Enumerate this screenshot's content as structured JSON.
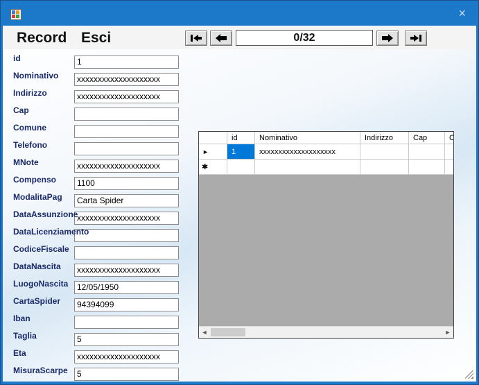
{
  "window": {
    "close_glyph": "×"
  },
  "menu": {
    "record": "Record",
    "exit": "Esci"
  },
  "nav": {
    "counter": "0/32",
    "first_icon": "first-record-icon",
    "prev_icon": "prev-record-icon",
    "next_icon": "next-record-icon",
    "last_icon": "last-record-icon"
  },
  "fields": [
    {
      "label": "id",
      "value": "1"
    },
    {
      "label": "Nominativo",
      "value": "xxxxxxxxxxxxxxxxxxxx"
    },
    {
      "label": "Indirizzo",
      "value": "xxxxxxxxxxxxxxxxxxxx"
    },
    {
      "label": "Cap",
      "value": ""
    },
    {
      "label": "Comune",
      "value": ""
    },
    {
      "label": "Telefono",
      "value": ""
    },
    {
      "label": "MNote",
      "value": "xxxxxxxxxxxxxxxxxxxx"
    },
    {
      "label": "Compenso",
      "value": "1100"
    },
    {
      "label": "ModalitaPag",
      "value": "Carta Spider"
    },
    {
      "label": "DataAssunzione",
      "value": "xxxxxxxxxxxxxxxxxxxx"
    },
    {
      "label": "DataLicenziamento",
      "value": ""
    },
    {
      "label": "CodiceFiscale",
      "value": ""
    },
    {
      "label": "DataNascita",
      "value": "xxxxxxxxxxxxxxxxxxxx"
    },
    {
      "label": "LuogoNascita",
      "value": "12/05/1950"
    },
    {
      "label": "CartaSpider",
      "value": "94394099"
    },
    {
      "label": "Iban",
      "value": ""
    },
    {
      "label": "Taglia",
      "value": "5"
    },
    {
      "label": "Eta",
      "value": "xxxxxxxxxxxxxxxxxxxx"
    },
    {
      "label": "MisuraScarpe",
      "value": "5"
    }
  ],
  "grid": {
    "columns": [
      "id",
      "Nominativo",
      "Indirizzo",
      "Cap",
      "C"
    ],
    "rows": [
      {
        "cells": [
          "1",
          "xxxxxxxxxxxxxxxxxxxx",
          "",
          "",
          ""
        ]
      }
    ],
    "current_row_glyph": "►",
    "new_row_glyph": "✱",
    "scroll_left_glyph": "◄",
    "scroll_right_glyph": "►"
  }
}
